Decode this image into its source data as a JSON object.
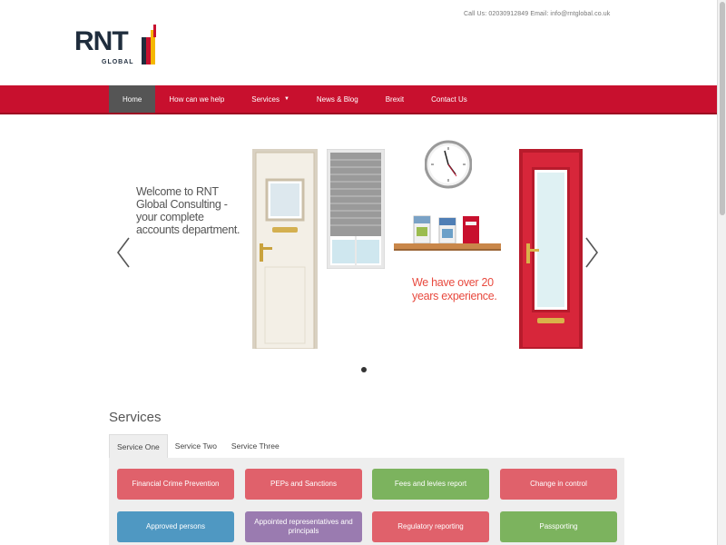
{
  "header": {
    "contact": "Call Us: 02030912849    Email: info@rntglobal.co.uk"
  },
  "logo": {
    "name": "RNT",
    "subtitle": "GLOBAL"
  },
  "nav": {
    "items": [
      {
        "label": "Home",
        "active": true
      },
      {
        "label": "How can we help",
        "active": false
      },
      {
        "label": "Services",
        "active": false,
        "dropdown": true
      },
      {
        "label": "News & Blog",
        "active": false
      },
      {
        "label": "Brexit",
        "active": false
      },
      {
        "label": "Contact Us",
        "active": false
      }
    ],
    "color": "#c8102e"
  },
  "carousel": {
    "caption_left": "Welcome to RNT Global Consulting - your complete accounts department.",
    "caption_right": "We have over 20 years experience.",
    "prev_icon": "chevron-left-icon",
    "next_icon": "chevron-right-icon"
  },
  "services": {
    "title": "Services",
    "tabs": [
      {
        "label": "Service One",
        "active": true
      },
      {
        "label": "Service Two",
        "active": false
      },
      {
        "label": "Service Three",
        "active": false
      }
    ],
    "buttons": [
      {
        "label": "Financial Crime Prevention",
        "color": "#e0616b"
      },
      {
        "label": "PEPs and Sanctions",
        "color": "#e0616b"
      },
      {
        "label": "Fees and levies report",
        "color": "#7cb35e"
      },
      {
        "label": "Change in control",
        "color": "#e0616b"
      },
      {
        "label": "Approved persons",
        "color": "#4f98c2"
      },
      {
        "label": "Appointed representatives and principals",
        "color": "#9a7bb0"
      },
      {
        "label": "Regulatory reporting",
        "color": "#e0616b"
      },
      {
        "label": "Passporting",
        "color": "#7cb35e"
      }
    ]
  }
}
